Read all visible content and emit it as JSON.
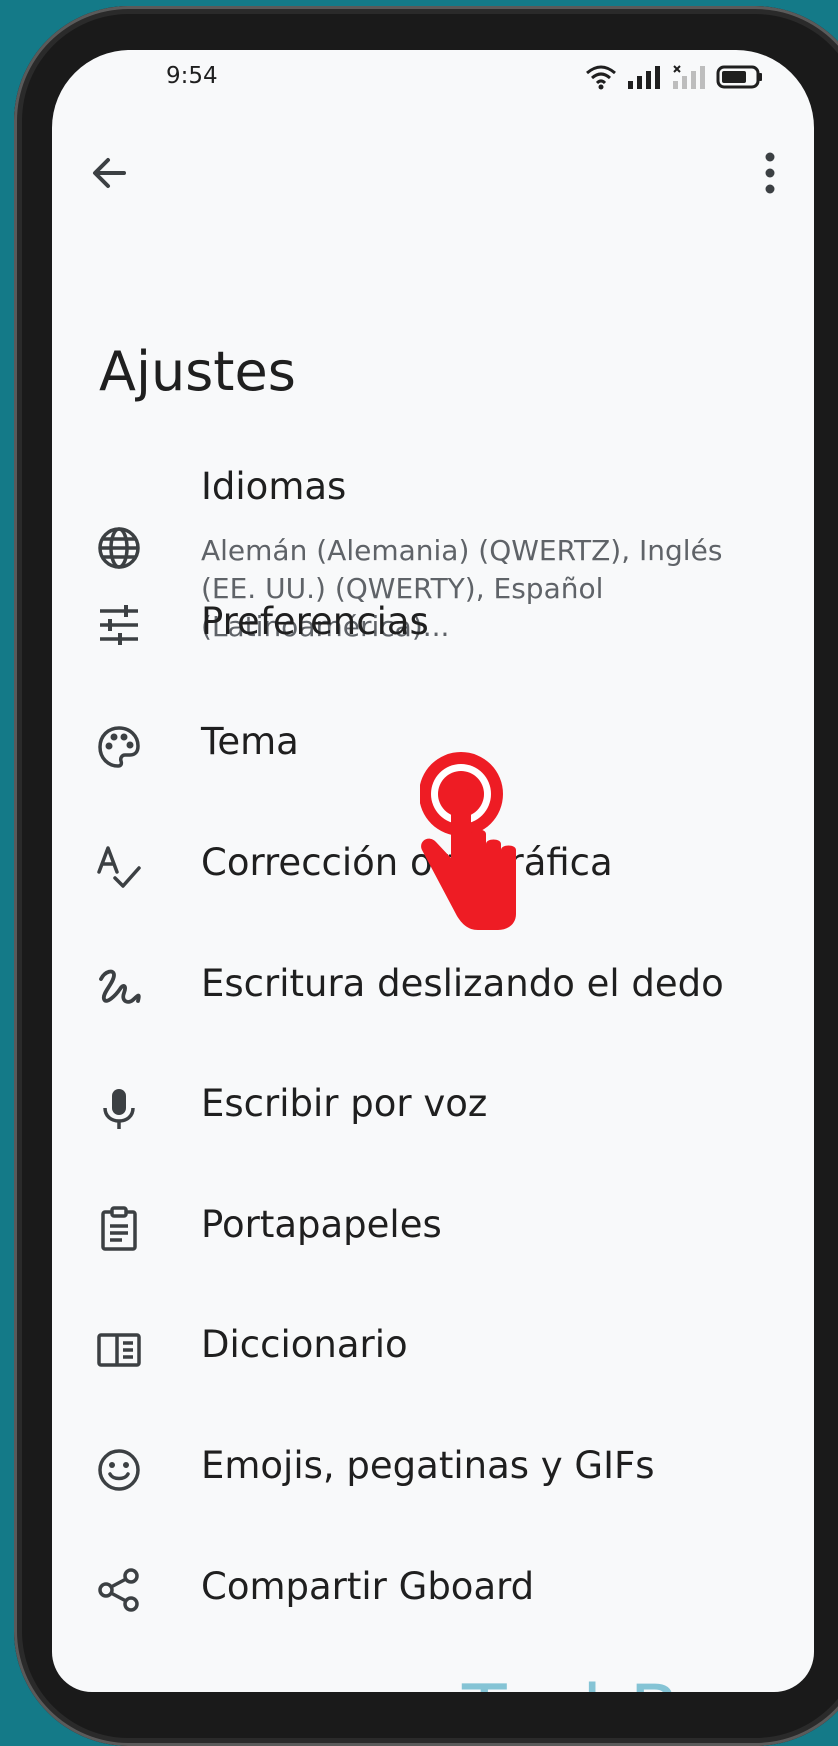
{
  "status_bar": {
    "time": "9:54"
  },
  "page": {
    "title": "Ajustes"
  },
  "settings": [
    {
      "label": "Idiomas",
      "subtitle": "Alemán (Alemania) (QWERTZ), Inglés (EE. UU.) (QWERTY), Español (Latinoamérica)...",
      "icon": "globe-icon"
    },
    {
      "label": "Preferencias",
      "icon": "tune-icon"
    },
    {
      "label": "Tema",
      "icon": "palette-icon"
    },
    {
      "label": "Corrección ortográfica",
      "icon": "spellcheck-icon"
    },
    {
      "label": "Escritura deslizando el dedo",
      "icon": "gesture-icon"
    },
    {
      "label": "Escribir por voz",
      "icon": "mic-icon"
    },
    {
      "label": "Portapapeles",
      "icon": "clipboard-icon"
    },
    {
      "label": "Diccionario",
      "icon": "dictionary-icon"
    },
    {
      "label": "Emojis, pegatinas y GIFs",
      "icon": "emoji-icon"
    },
    {
      "label": "Compartir Gboard",
      "icon": "share-icon"
    }
  ],
  "watermark": "TechBone",
  "colors": {
    "background": "#147a88",
    "screen": "#f8f9fa",
    "text": "#1f1f1f",
    "hand": "#ee1c24"
  }
}
